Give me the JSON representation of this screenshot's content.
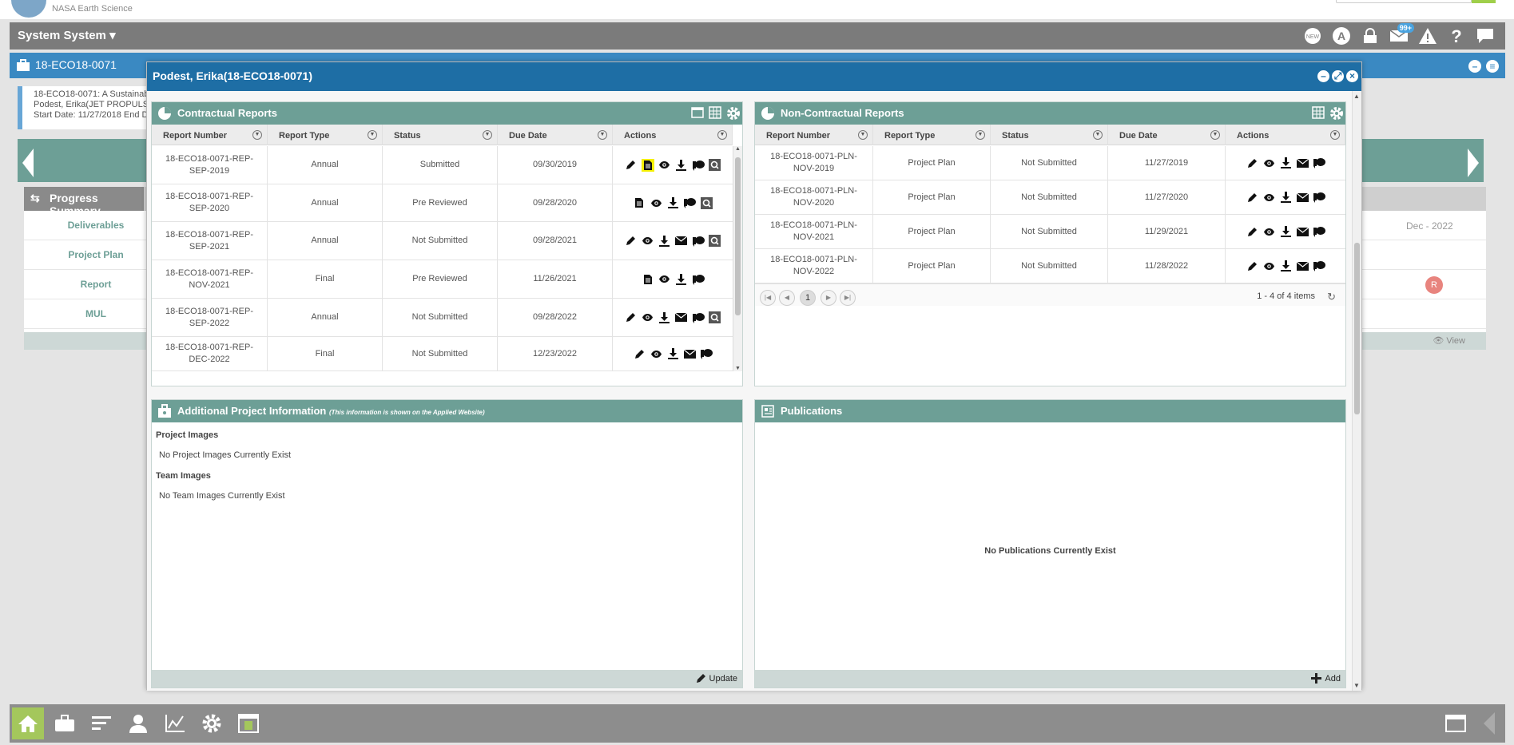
{
  "topbar": {
    "org": "NASA Earth Science"
  },
  "systembar": {
    "user_menu": "System System ▾",
    "badge_count": "99+",
    "new_label": "NEW"
  },
  "background": {
    "panel_title": "18-ECO18-0071",
    "info_lines": [
      "18-ECO18-0071: A Sustainabl",
      "Podest, Erika(JET PROPULS",
      "Start Date: 11/27/2018 End D"
    ],
    "progress_title": "Progress Summary",
    "progress_rows": [
      "Deliverables",
      "Project Plan",
      "Report",
      "MUL"
    ],
    "dec_label": "Dec - 2022",
    "r_badge": "R",
    "view_label": "View"
  },
  "modal": {
    "title": "Podest, Erika(18-ECO18-0071)",
    "contractual": {
      "title": "Contractual Reports",
      "columns": [
        "Report Number",
        "Report Type",
        "Status",
        "Due Date",
        "Actions"
      ],
      "rows": [
        {
          "number": "18-ECO18-0071-REP-SEP-2019",
          "type": "Annual",
          "status": "Submitted",
          "due": "09/30/2019",
          "actions": [
            "edit-icon",
            "document-icon",
            "eye-icon",
            "download-icon",
            "comment-icon",
            "q-icon"
          ],
          "highlight": 1
        },
        {
          "number": "18-ECO18-0071-REP-SEP-2020",
          "type": "Annual",
          "status": "Pre Reviewed",
          "due": "09/28/2020",
          "actions": [
            "document-icon",
            "eye-icon",
            "download-icon",
            "comment-icon",
            "q-icon"
          ],
          "highlight": -1
        },
        {
          "number": "18-ECO18-0071-REP-SEP-2021",
          "type": "Annual",
          "status": "Not Submitted",
          "due": "09/28/2021",
          "actions": [
            "edit-icon",
            "eye-icon",
            "download-icon",
            "mail-icon",
            "comment-icon",
            "q-icon"
          ],
          "highlight": -1
        },
        {
          "number": "18-ECO18-0071-REP-NOV-2021",
          "type": "Final",
          "status": "Pre Reviewed",
          "due": "11/26/2021",
          "actions": [
            "document-icon",
            "eye-icon",
            "download-icon",
            "comment-icon"
          ],
          "highlight": -1
        },
        {
          "number": "18-ECO18-0071-REP-SEP-2022",
          "type": "Annual",
          "status": "Not Submitted",
          "due": "09/28/2022",
          "actions": [
            "edit-icon",
            "eye-icon",
            "download-icon",
            "mail-icon",
            "comment-icon",
            "q-icon"
          ],
          "highlight": -1
        },
        {
          "number": "18-ECO18-0071-REP-DEC-2022",
          "type": "Final",
          "status": "Not Submitted",
          "due": "12/23/2022",
          "actions": [
            "edit-icon",
            "eye-icon",
            "download-icon",
            "mail-icon",
            "comment-icon"
          ],
          "highlight": -1
        }
      ]
    },
    "noncontractual": {
      "title": "Non-Contractual Reports",
      "columns": [
        "Report Number",
        "Report Type",
        "Status",
        "Due Date",
        "Actions"
      ],
      "rows": [
        {
          "number": "18-ECO18-0071-PLN-NOV-2019",
          "type": "Project Plan",
          "status": "Not Submitted",
          "due": "11/27/2019",
          "actions": [
            "edit-icon",
            "eye-icon",
            "download-icon",
            "mail-icon",
            "comment-icon"
          ]
        },
        {
          "number": "18-ECO18-0071-PLN-NOV-2020",
          "type": "Project Plan",
          "status": "Not Submitted",
          "due": "11/27/2020",
          "actions": [
            "edit-icon",
            "eye-icon",
            "download-icon",
            "mail-icon",
            "comment-icon"
          ]
        },
        {
          "number": "18-ECO18-0071-PLN-NOV-2021",
          "type": "Project Plan",
          "status": "Not Submitted",
          "due": "11/29/2021",
          "actions": [
            "edit-icon",
            "eye-icon",
            "download-icon",
            "mail-icon",
            "comment-icon"
          ]
        },
        {
          "number": "18-ECO18-0071-PLN-NOV-2022",
          "type": "Project Plan",
          "status": "Not Submitted",
          "due": "11/28/2022",
          "actions": [
            "edit-icon",
            "eye-icon",
            "download-icon",
            "mail-icon",
            "comment-icon"
          ]
        }
      ],
      "page": "1",
      "items_label": "1 - 4 of 4 items"
    },
    "additional": {
      "title": "Additional Project Information",
      "note": "(This information is shown on the Applied Website)",
      "project_images_label": "Project Images",
      "project_images_empty": "No Project Images Currently Exist",
      "team_images_label": "Team Images",
      "team_images_empty": "No Team Images Currently Exist",
      "update_label": "Update"
    },
    "publications": {
      "title": "Publications",
      "empty": "No Publications Currently Exist",
      "add_label": "Add"
    }
  },
  "colors": {
    "panel_header": "#6d9f96",
    "modal_header": "#1e6ea5",
    "highlight": "#f5f000",
    "dock_active": "#a4c75c"
  }
}
